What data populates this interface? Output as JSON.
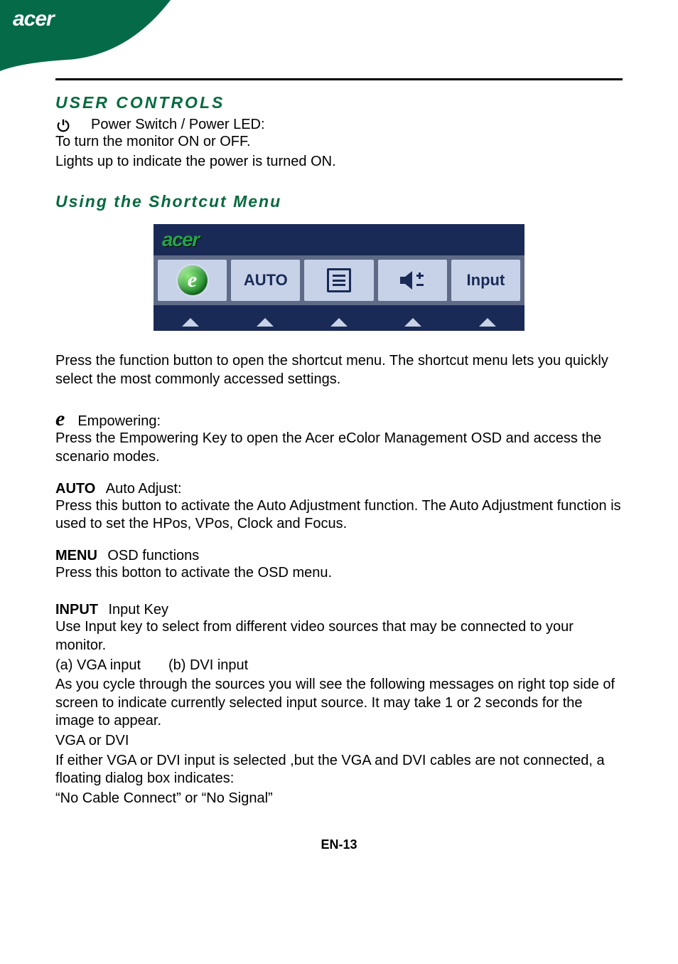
{
  "header": {
    "brand": "acer"
  },
  "section1": {
    "title": "USER CONTROLS",
    "power_label": "Power Switch / Power LED:",
    "power_line1": "To turn the monitor ON or OFF.",
    "power_line2": "Lights up to indicate the power is turned ON."
  },
  "section2": {
    "title": "Using   the  Shortcut  Menu"
  },
  "osd": {
    "logo": "acer",
    "auto": "AUTO",
    "input": "Input"
  },
  "intro": "Press the function button to open the shortcut menu. The shortcut menu lets you quickly select the most commonly accessed settings.",
  "empowering": {
    "title": "Empowering:",
    "body": "Press the Empowering Key to open the Acer eColor Management OSD and access the scenario modes."
  },
  "auto": {
    "prefix": "AUTO",
    "title": "Auto Adjust:",
    "body": "Press this button to activate the Auto Adjustment function. The Auto Adjustment function is used to set the HPos, VPos, Clock and Focus."
  },
  "menu": {
    "prefix": "MENU",
    "title": "OSD functions",
    "body": "Press this botton to activate the OSD menu."
  },
  "input": {
    "prefix": "INPUT",
    "title": "Input Key",
    "l1": "Use Input key to select from different video sources that may be connected to your monitor.",
    "l2": "(a) VGA input       (b) DVI input",
    "l3": "As you cycle through the sources you will see the following messages on right top side of screen to indicate currently selected input source. It may take 1 or 2 seconds for the image to appear.",
    "l4": "VGA   or  DVI",
    "l5": "If either VGA or DVI input is selected ,but the VGA and DVI cables are not connected, a floating dialog box indicates:",
    "l6": "“No Cable Connect” or “No Signal”"
  },
  "footer": "EN-13"
}
